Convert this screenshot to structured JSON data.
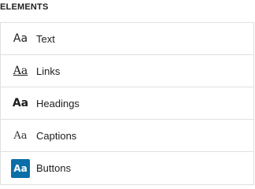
{
  "section": {
    "title": "ELEMENTS"
  },
  "elements": [
    {
      "label": "Text",
      "swatch": "Aa",
      "style": "text"
    },
    {
      "label": "Links",
      "swatch": "Aa",
      "style": "links"
    },
    {
      "label": "Headings",
      "swatch": "Aa",
      "style": "headings"
    },
    {
      "label": "Captions",
      "swatch": "Aa",
      "style": "captions"
    },
    {
      "label": "Buttons",
      "swatch": "Aa",
      "style": "buttons"
    }
  ],
  "colors": {
    "button_swatch_bg": "#0b6ea8",
    "border": "#e0e0e0"
  }
}
